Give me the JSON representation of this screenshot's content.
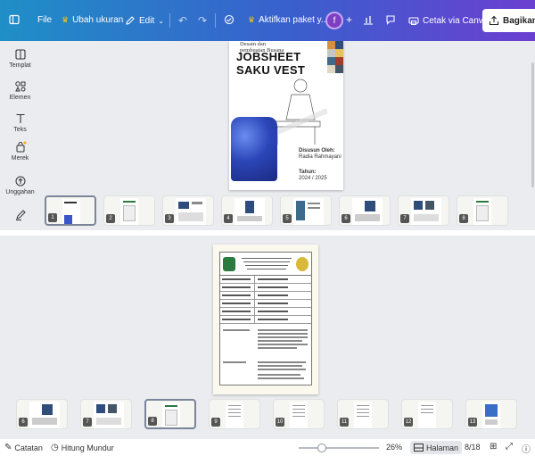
{
  "topbar": {
    "file": "File",
    "resize": "Ubah ukuran",
    "edit": "Edit",
    "trial": "Aktifkan paket y...",
    "avatar_initial": "f",
    "print": "Cetak via Canva",
    "share": "Bagikan"
  },
  "sidebar": {
    "items": [
      {
        "label": "Templat",
        "icon": "template-icon"
      },
      {
        "label": "Elemen",
        "icon": "elements-icon"
      },
      {
        "label": "Teks",
        "icon": "text-icon"
      },
      {
        "label": "Merek",
        "icon": "brand-icon"
      },
      {
        "label": "Unggahan",
        "icon": "upload-icon"
      },
      {
        "label": "",
        "icon": "draw-icon"
      }
    ]
  },
  "page1": {
    "top_text_1": "Desain dan",
    "top_text_2": "pembuatan Busana",
    "title_line1": "JOBSHEET",
    "title_line2": "SAKU VEST",
    "by_label": "Disusun Oleh:",
    "by_name": "Radia Rahmayani",
    "year_label": "Tahun:",
    "year_value": "2024 / 2025"
  },
  "strip1": {
    "thumbs": [
      "1",
      "2",
      "3",
      "4",
      "5",
      "6",
      "7",
      "8"
    ],
    "selected": "1"
  },
  "strip2": {
    "thumbs": [
      "6",
      "7",
      "8",
      "9",
      "10",
      "11",
      "12",
      "13"
    ],
    "selected": "8"
  },
  "status": {
    "notes": "Catatan",
    "timer": "Hitung Mundur",
    "zoom": "26%",
    "zoom_level": 0.26,
    "pages_label": "Halaman",
    "page_counter": "8/18"
  },
  "colors": {
    "accent_purple": "#7d3fc2",
    "topbar_start": "#1f8fc7",
    "topbar_end": "#6b3fd0",
    "crown": "#f5c518"
  }
}
